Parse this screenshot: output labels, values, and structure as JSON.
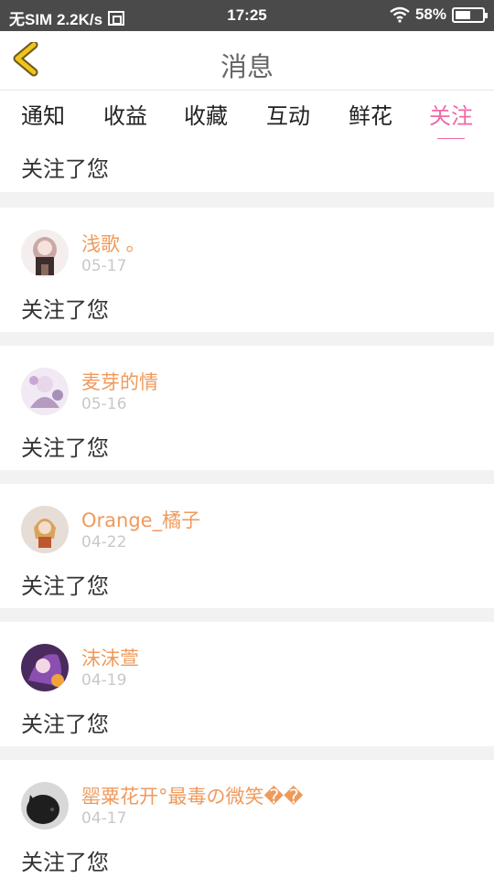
{
  "status_bar": {
    "carrier": "无SIM 2.2K/s",
    "time": "17:25",
    "battery": "58%",
    "battery_level": 0.58
  },
  "header": {
    "title": "消息",
    "back_icon": "chevron-left-icon",
    "accent_color": "#f0c419"
  },
  "tabs": [
    {
      "label": "通知"
    },
    {
      "label": "收益"
    },
    {
      "label": "收藏"
    },
    {
      "label": "互动"
    },
    {
      "label": "鲜花"
    },
    {
      "label": "关注",
      "active": true
    }
  ],
  "colors": {
    "active_tab": "#ee6aa6",
    "username": "#ef9a5c",
    "date": "#c8c8c8"
  },
  "notifications": [
    {
      "message": "关注了您"
    },
    {
      "name": "浅歌 。",
      "date": "05-17",
      "message": "关注了您"
    },
    {
      "name": "麦芽的情",
      "date": "05-16",
      "message": "关注了您"
    },
    {
      "name": "Orange_橘子",
      "date": "04-22",
      "message": "关注了您"
    },
    {
      "name": "沫沫萱",
      "date": "04-19",
      "message": "关注了您"
    },
    {
      "name": "罂粟花开°最毒の微笑��",
      "date": "04-17",
      "message": "关注了您"
    }
  ]
}
